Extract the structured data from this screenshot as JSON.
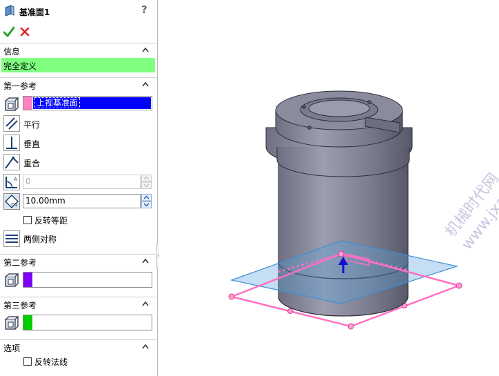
{
  "header": {
    "title": "基准面1",
    "help": "?"
  },
  "sections": {
    "info": {
      "label": "信息",
      "status": "完全定义"
    },
    "first_ref": {
      "label": "第一参考",
      "selection": "上视基准面",
      "options": [
        "平行",
        "垂直",
        "重合"
      ],
      "angle_value": "0",
      "offset_value": "10.00mm",
      "flip_offset_label": "反转等距",
      "both_sides_label": "两侧对称"
    },
    "second_ref": {
      "label": "第二参考"
    },
    "third_ref": {
      "label": "第三参考"
    },
    "options": {
      "label": "选项",
      "flip_normal_label": "反转法线"
    }
  },
  "watermark": {
    "line1": "机械时代网",
    "line2": "www.jxage.com"
  },
  "colors": {
    "status_green": "#80ff80",
    "selection_blue": "#0000ff",
    "swatch_pink": "#ff80c0",
    "swatch_purple": "#8000ff",
    "swatch_green": "#00cc00",
    "plane_blue": "#3c8fd8",
    "preview_pink": "#ff70c0"
  }
}
